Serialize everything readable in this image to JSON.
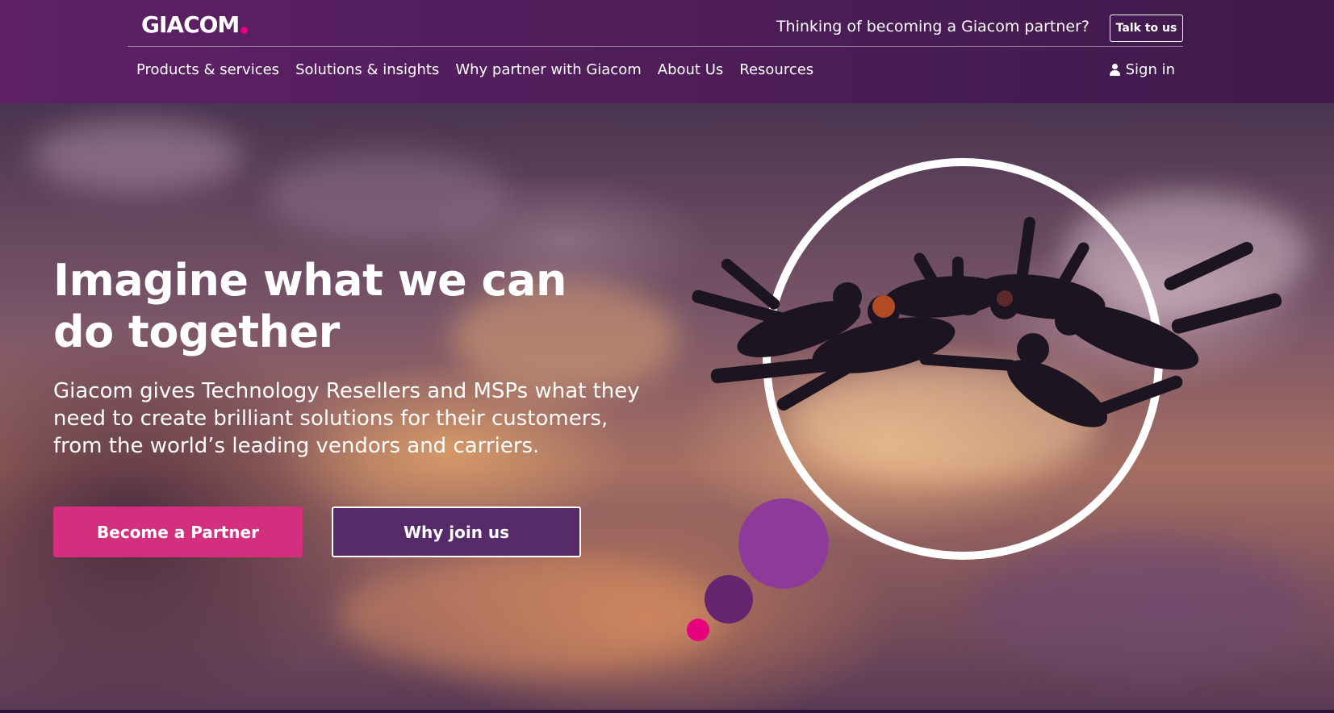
{
  "header": {
    "logo_text": "GIACOM",
    "promo_text": "Thinking of becoming a Giacom partner?",
    "talk_button": "Talk to us",
    "nav": [
      {
        "label": "Products & services"
      },
      {
        "label": "Solutions & insights"
      },
      {
        "label": "Why partner with Giacom"
      },
      {
        "label": "About Us"
      },
      {
        "label": "Resources"
      }
    ],
    "sign_in": "Sign in"
  },
  "hero": {
    "title": "Imagine what we can do together",
    "description": "Giacom gives Technology Resellers and MSPs what they need to create brilliant solutions for their customers, from the world’s leading vendors and carriers.",
    "primary_button": "Become a Partner",
    "secondary_button": "Why join us"
  },
  "colors": {
    "header_purple": "#5e2166",
    "accent_pink": "#d42f7f",
    "logo_dot": "#e6007e",
    "secondary_purple": "#572a6a"
  }
}
